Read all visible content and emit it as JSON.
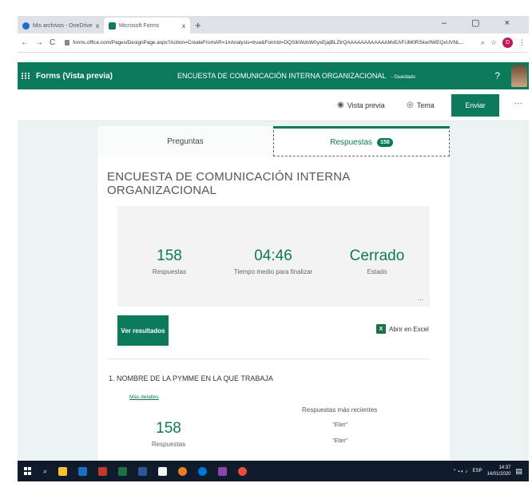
{
  "browser": {
    "tabs": [
      {
        "label": "Mis archivos - OneDrive",
        "close": "x"
      },
      {
        "label": "Microsoft Forms",
        "close": "x"
      }
    ],
    "new_tab": "+",
    "window_controls": "– ▢ ×",
    "url": "forms.office.com/Pages/DesignPage.aspx?Action=CreateFromAR=1#Analysis=true&FormId=DQSIkWdsW0yxEjajBLZtrQAAAAAAAAAAAAMxEAFUM0RSkw0WEQxUVNL..."
  },
  "header": {
    "app_name": "Forms (Vista previa)",
    "form_title": "ENCUESTA DE COMUNICACIÓN INTERNA ORGANIZACIONAL",
    "saved_status": "- Guardado",
    "help": "?"
  },
  "commandbar": {
    "preview": "Vista previa",
    "theme": "Tema",
    "send": "Enviar",
    "more": "···"
  },
  "tabs": {
    "questions": "Preguntas",
    "responses": "Respuestas",
    "responses_count": "158"
  },
  "summary": {
    "title": "ENCUESTA DE COMUNICACIÓN INTERNA ORGANIZACIONAL",
    "responses_value": "158",
    "responses_label": "Respuestas",
    "time_value": "04:46",
    "time_label": "Tiempo medio para finalizar",
    "status_value": "Cerrado",
    "status_label": "Estado",
    "more": "...",
    "view_results": "Ver resultados",
    "open_excel": "Abrir en Excel",
    "excel_letter": "X"
  },
  "question1": {
    "title": "1. NOMBRE DE LA PYMME EN LA QUE TRABAJA",
    "details_link": "Más detalles",
    "count_value": "158",
    "count_label": "Respuestas",
    "recent_title": "Respuestas más recientes",
    "recent": [
      "\"Elan\"",
      "\"Elan\""
    ]
  },
  "taskbar": {
    "lang": "ESP",
    "time": "14:37",
    "date": "14/01/2020"
  },
  "colors": {
    "brand_green": "#0b7a5b",
    "canvas_bg": "#eaf3f1",
    "taskbar_bg": "#0f1a2a"
  }
}
